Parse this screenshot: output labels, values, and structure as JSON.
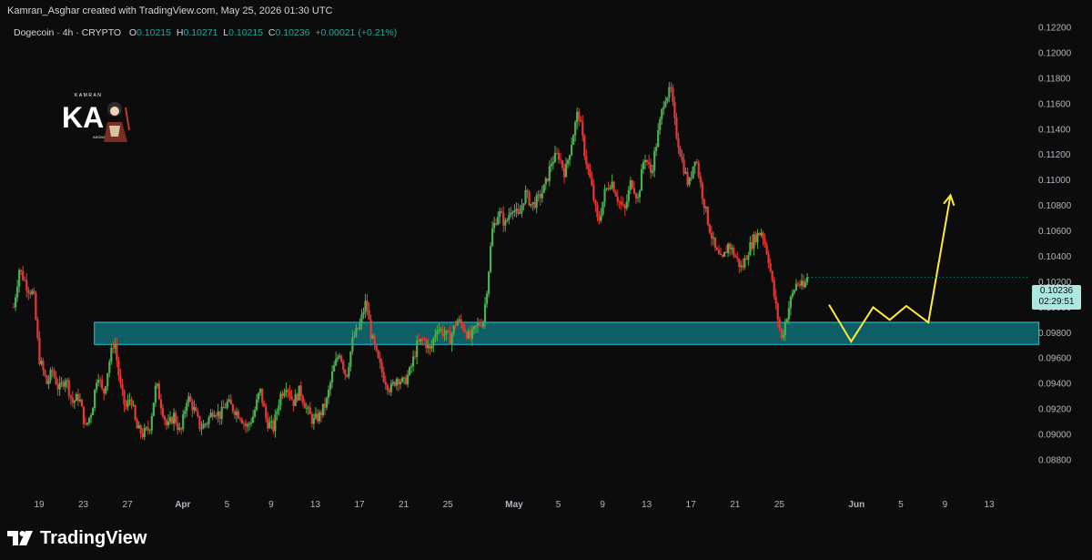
{
  "header": {
    "credit": "Kamran_Asghar created with TradingView.com, May 25, 2026 01:30 UTC"
  },
  "symbol_bar": {
    "name": "Dogecoin · 4h · CRYPTO",
    "open_label": "O",
    "open": "0.10215",
    "high_label": "H",
    "high": "0.10271",
    "low_label": "L",
    "low": "0.10215",
    "close_label": "C",
    "close": "0.10236",
    "change": "+0.00021 (+0.21%)"
  },
  "price_badge": {
    "price": "0.10236",
    "countdown": "02:29:51"
  },
  "logo": {
    "text": "TradingView"
  },
  "watermark": {
    "text_top": "KAMRAN",
    "text_bottom": "ASGHAR",
    "mark": "KA"
  },
  "colors": {
    "background": "#0c0c0c",
    "up": "#26a69a",
    "up_candle": "#4caf50",
    "down": "#e53935",
    "zone_fill": "#0f6d75",
    "zone_border": "#26c6da",
    "projection": "#ffeb3b",
    "axis_text": "#b2b5be"
  },
  "chart_data": {
    "type": "candlestick",
    "title": "Dogecoin · 4h · CRYPTO",
    "y_ticks": [
      "0.12200",
      "0.12000",
      "0.11800",
      "0.11600",
      "0.11400",
      "0.11200",
      "0.11000",
      "0.10800",
      "0.10600",
      "0.10400",
      "0.10200",
      "0.10000",
      "0.09800",
      "0.09600",
      "0.09400",
      "0.09200",
      "0.09000",
      "0.08800"
    ],
    "ylim": [
      0.0875,
      0.1222
    ],
    "x_ticks": [
      {
        "label": "19",
        "day": 0
      },
      {
        "label": "23",
        "day": 4
      },
      {
        "label": "27",
        "day": 8
      },
      {
        "label": "Apr",
        "day": 13
      },
      {
        "label": "5",
        "day": 17
      },
      {
        "label": "9",
        "day": 21
      },
      {
        "label": "13",
        "day": 25
      },
      {
        "label": "17",
        "day": 29
      },
      {
        "label": "21",
        "day": 33
      },
      {
        "label": "25",
        "day": 37
      },
      {
        "label": "May",
        "day": 43
      },
      {
        "label": "5",
        "day": 47
      },
      {
        "label": "9",
        "day": 51
      },
      {
        "label": "13",
        "day": 55
      },
      {
        "label": "17",
        "day": 59
      },
      {
        "label": "21",
        "day": 63
      },
      {
        "label": "25",
        "day": 67
      },
      {
        "label": "Jun",
        "day": 74
      },
      {
        "label": "5",
        "day": 78
      },
      {
        "label": "9",
        "day": 82
      },
      {
        "label": "13",
        "day": 86
      }
    ],
    "bold_x_ticks": [
      "Apr",
      "May",
      "Jun"
    ],
    "xlim_days": [
      -2.5,
      93.5
    ],
    "price_path": [
      [
        -2.3,
        0.1
      ],
      [
        -1.8,
        0.103
      ],
      [
        -1.0,
        0.1015
      ],
      [
        -0.5,
        0.101
      ],
      [
        0.0,
        0.096
      ],
      [
        0.7,
        0.094
      ],
      [
        1.2,
        0.095
      ],
      [
        1.8,
        0.0935
      ],
      [
        2.4,
        0.0945
      ],
      [
        3.0,
        0.0925
      ],
      [
        3.6,
        0.093
      ],
      [
        4.2,
        0.0905
      ],
      [
        4.8,
        0.092
      ],
      [
        5.3,
        0.095
      ],
      [
        5.8,
        0.093
      ],
      [
        6.3,
        0.0955
      ],
      [
        6.8,
        0.0975
      ],
      [
        7.3,
        0.094
      ],
      [
        7.8,
        0.092
      ],
      [
        8.3,
        0.093
      ],
      [
        8.8,
        0.0905
      ],
      [
        9.4,
        0.09
      ],
      [
        10.0,
        0.0905
      ],
      [
        10.6,
        0.094
      ],
      [
        11.0,
        0.0925
      ],
      [
        11.6,
        0.0905
      ],
      [
        12.2,
        0.0915
      ],
      [
        12.8,
        0.09
      ],
      [
        13.4,
        0.093
      ],
      [
        14.0,
        0.092
      ],
      [
        14.6,
        0.0905
      ],
      [
        15.2,
        0.091
      ],
      [
        15.8,
        0.092
      ],
      [
        16.4,
        0.0915
      ],
      [
        17.0,
        0.0925
      ],
      [
        17.6,
        0.092
      ],
      [
        18.2,
        0.0915
      ],
      [
        18.8,
        0.0905
      ],
      [
        19.4,
        0.0915
      ],
      [
        20.0,
        0.0935
      ],
      [
        20.6,
        0.091
      ],
      [
        21.2,
        0.0905
      ],
      [
        21.8,
        0.093
      ],
      [
        22.4,
        0.094
      ],
      [
        23.0,
        0.0925
      ],
      [
        23.6,
        0.0935
      ],
      [
        24.2,
        0.092
      ],
      [
        24.8,
        0.091
      ],
      [
        25.4,
        0.0915
      ],
      [
        26.0,
        0.0925
      ],
      [
        26.6,
        0.095
      ],
      [
        27.2,
        0.0965
      ],
      [
        27.8,
        0.0945
      ],
      [
        28.4,
        0.0975
      ],
      [
        29.0,
        0.0985
      ],
      [
        29.6,
        0.1005
      ],
      [
        30.0,
        0.098
      ],
      [
        30.6,
        0.096
      ],
      [
        31.2,
        0.0945
      ],
      [
        31.8,
        0.0935
      ],
      [
        32.4,
        0.0945
      ],
      [
        33.0,
        0.094
      ],
      [
        33.6,
        0.095
      ],
      [
        34.2,
        0.097
      ],
      [
        34.8,
        0.0975
      ],
      [
        35.4,
        0.0965
      ],
      [
        36.0,
        0.0985
      ],
      [
        36.6,
        0.098
      ],
      [
        37.2,
        0.0975
      ],
      [
        37.8,
        0.099
      ],
      [
        38.4,
        0.0985
      ],
      [
        39.0,
        0.0975
      ],
      [
        39.6,
        0.0985
      ],
      [
        40.2,
        0.099
      ],
      [
        40.6,
        0.102
      ],
      [
        41.0,
        0.106
      ],
      [
        41.6,
        0.1075
      ],
      [
        42.2,
        0.1065
      ],
      [
        42.8,
        0.108
      ],
      [
        43.4,
        0.107
      ],
      [
        44.0,
        0.109
      ],
      [
        44.6,
        0.108
      ],
      [
        45.2,
        0.1085
      ],
      [
        45.8,
        0.1095
      ],
      [
        46.4,
        0.1115
      ],
      [
        47.0,
        0.112
      ],
      [
        47.6,
        0.1105
      ],
      [
        48.2,
        0.113
      ],
      [
        48.8,
        0.1155
      ],
      [
        49.4,
        0.112
      ],
      [
        50.0,
        0.1095
      ],
      [
        50.6,
        0.1065
      ],
      [
        51.2,
        0.109
      ],
      [
        51.8,
        0.11
      ],
      [
        52.4,
        0.1085
      ],
      [
        53.0,
        0.1075
      ],
      [
        53.6,
        0.11
      ],
      [
        54.2,
        0.1085
      ],
      [
        54.8,
        0.112
      ],
      [
        55.4,
        0.1105
      ],
      [
        56.0,
        0.1135
      ],
      [
        56.6,
        0.1165
      ],
      [
        57.2,
        0.117
      ],
      [
        57.6,
        0.114
      ],
      [
        58.2,
        0.1115
      ],
      [
        58.8,
        0.1095
      ],
      [
        59.4,
        0.112
      ],
      [
        60.0,
        0.109
      ],
      [
        60.6,
        0.1065
      ],
      [
        61.2,
        0.1045
      ],
      [
        61.8,
        0.1035
      ],
      [
        62.4,
        0.105
      ],
      [
        63.0,
        0.104
      ],
      [
        63.6,
        0.103
      ],
      [
        64.2,
        0.1045
      ],
      [
        64.8,
        0.1055
      ],
      [
        65.4,
        0.106
      ],
      [
        66.0,
        0.104
      ],
      [
        66.6,
        0.1005
      ],
      [
        67.2,
        0.0975
      ],
      [
        67.6,
        0.099
      ],
      [
        68.0,
        0.1005
      ],
      [
        68.6,
        0.102
      ],
      [
        69.2,
        0.1015
      ],
      [
        69.6,
        0.1024
      ]
    ],
    "last_price": 0.10236,
    "support_zone": {
      "price_low": 0.09707,
      "price_high": 0.09881,
      "day_start": 5.0,
      "day_end": 90.5
    },
    "projection_path": [
      [
        71.5,
        0.1002
      ],
      [
        73.5,
        0.0973
      ],
      [
        75.5,
        0.1
      ],
      [
        77.0,
        0.099
      ],
      [
        78.5,
        0.1001
      ],
      [
        80.5,
        0.0988
      ],
      [
        82.5,
        0.1088
      ]
    ]
  }
}
